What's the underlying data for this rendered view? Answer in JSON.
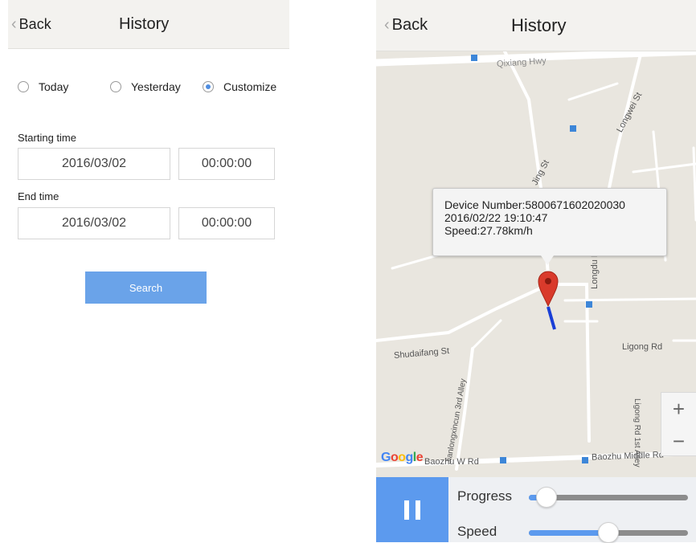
{
  "left": {
    "header": {
      "back_label": "Back",
      "title": "History"
    },
    "range_options": [
      {
        "label": "Today",
        "selected": false
      },
      {
        "label": "Yesterday",
        "selected": false
      },
      {
        "label": "Customize",
        "selected": true
      }
    ],
    "start": {
      "label": "Starting time",
      "date": "2016/03/02",
      "time": "00:00:00"
    },
    "end": {
      "label": "End time",
      "date": "2016/03/02",
      "time": "00:00:00"
    },
    "search_label": "Search"
  },
  "right": {
    "header": {
      "back_label": "Back",
      "title": "History"
    },
    "map": {
      "streets": {
        "top_hwy": "Qixiang Hwy",
        "longwei": "Longwei St",
        "jing": "Jing St",
        "longdu": "Longdu R",
        "shudaifang": "Shudaifang St",
        "ligong_rd": "Ligong Rd",
        "ligong_alley": "Ligong Rd 1st Alley",
        "jianlong": "Jianlongxincun 3rd Alley",
        "baozhu": "Baozhu Middle Rd",
        "baozhu_w": "Baozhu W Rd"
      },
      "google_label": "Google",
      "zoom_in": "+",
      "zoom_out": "−"
    },
    "info": {
      "device": "Device Number:5800671602020030",
      "datetime": "2016/02/22 19:10:47",
      "speed": "Speed:27.78km/h"
    },
    "controls": {
      "progress_label": "Progress",
      "speed_label": "Speed",
      "progress_value": 0.05,
      "speed_value": 0.5
    }
  },
  "colors": {
    "accent": "#5c9aee",
    "button": "#6aa3e9",
    "marker": "#d93a2b",
    "route": "#1a3fd6",
    "map_bg": "#e9e6df"
  }
}
